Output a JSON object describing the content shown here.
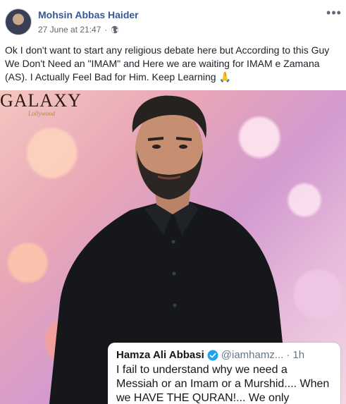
{
  "post": {
    "author": "Mohsin Abbas Haider",
    "timestamp": "27 June at 21:47",
    "separator": "·",
    "privacy_icon": "globe-icon",
    "more_icon": "more-horizontal-icon",
    "more_label": "•••",
    "text": "Ok I don't want to start any religious debate here but According to this Guy We Don't Need an \"IMAM\" and Here we are waiting for IMAM e Zamana (AS). I Actually Feel Bad for Him. Keep Learning 🙏"
  },
  "photo": {
    "logo_text": "GALAXY",
    "logo_subtext": "Lollywood",
    "tweet": {
      "name": "Hamza Ali Abbasi",
      "verified_icon": "verified-badge-icon",
      "handle": "@iamhamz...",
      "separator": "·",
      "time": "1h",
      "text": "I fail to understand why we need a Messiah or an Imam or a Murshid.... When we HAVE THE QURAN!... We only"
    }
  },
  "colors": {
    "author_link": "#365899",
    "meta_text": "#616770",
    "body_text": "#1d2129",
    "verified_blue": "#1da1f2"
  }
}
